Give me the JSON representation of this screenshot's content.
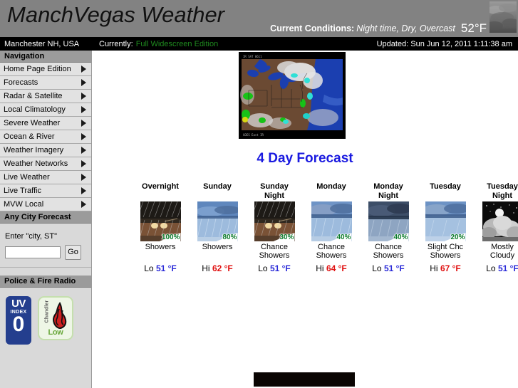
{
  "header": {
    "site_title": "ManchVegas Weather",
    "conditions_label": "Current Conditions:",
    "conditions_text": "Night time, Dry, Overcast",
    "temperature": "52°F",
    "sky_thumb_icon": "overcast-sky-photo"
  },
  "statusbar": {
    "location": "Manchester NH, USA",
    "currently_label": "Currently:",
    "edition": "Full Widescreen Edition",
    "updated": "Updated: Sun  Jun 12, 2011  1:11:38 am"
  },
  "sidebar": {
    "nav_heading": "Navigation",
    "nav_items": [
      {
        "label": "Home Page Edition",
        "icon": "chevron-right-icon"
      },
      {
        "label": "Forecasts",
        "icon": "chevron-right-icon"
      },
      {
        "label": "Radar & Satellite",
        "icon": "chevron-right-icon"
      },
      {
        "label": "Local Climatology",
        "icon": "chevron-right-icon"
      },
      {
        "label": "Severe Weather",
        "icon": "chevron-right-icon"
      },
      {
        "label": "Ocean & River",
        "icon": "chevron-right-icon"
      },
      {
        "label": "Weather Imagery",
        "icon": "chevron-right-icon"
      },
      {
        "label": "Weather Networks",
        "icon": "chevron-right-icon"
      },
      {
        "label": "Live Weather",
        "icon": "chevron-right-icon"
      },
      {
        "label": "Live Traffic",
        "icon": "chevron-right-icon"
      },
      {
        "label": "MVW Local",
        "icon": "chevron-right-icon"
      }
    ],
    "city_heading": "Any City Forecast",
    "city_label": "Enter \"city, ST\"",
    "city_value": "",
    "city_placeholder": "",
    "go_label": "Go",
    "radio_heading": "Police & Fire Radio",
    "uv": {
      "word": "UV",
      "index_word": "INDEX",
      "value": "0"
    },
    "fire": {
      "scale": "Chandler",
      "level": "Low",
      "icon": "flame-icon"
    }
  },
  "main": {
    "radar_icon": "radar-satellite-map",
    "forecast_title": "4 Day Forecast",
    "forecast": [
      {
        "day": "Overnight",
        "icon": "night-showers-icon",
        "pop": "100%",
        "desc": "Showers",
        "temp_label": "Lo",
        "temp_value": "51 °F",
        "temp_kind": "lo"
      },
      {
        "day": "Sunday",
        "icon": "day-showers-icon",
        "pop": "80%",
        "desc": "Showers",
        "temp_label": "Hi",
        "temp_value": "62 °F",
        "temp_kind": "hi"
      },
      {
        "day": "Sunday Night",
        "icon": "night-chance-showers-icon",
        "pop": "30%",
        "desc": "Chance Showers",
        "temp_label": "Lo",
        "temp_value": "51 °F",
        "temp_kind": "lo"
      },
      {
        "day": "Monday",
        "icon": "day-chance-showers-icon",
        "pop": "40%",
        "desc": "Chance Showers",
        "temp_label": "Hi",
        "temp_value": "64 °F",
        "temp_kind": "hi"
      },
      {
        "day": "Monday Night",
        "icon": "night-chance-showers-icon",
        "pop": "40%",
        "desc": "Chance Showers",
        "temp_label": "Lo",
        "temp_value": "51 °F",
        "temp_kind": "lo"
      },
      {
        "day": "Tuesday",
        "icon": "day-slight-chance-showers-icon",
        "pop": "20%",
        "desc": "Slight Chc Showers",
        "temp_label": "Hi",
        "temp_value": "67 °F",
        "temp_kind": "hi"
      },
      {
        "day": "Tuesday Night",
        "icon": "night-mostly-cloudy-icon",
        "pop": "",
        "desc": "Mostly Cloudy",
        "temp_label": "Lo",
        "temp_value": "51 °F",
        "temp_kind": "lo"
      }
    ]
  },
  "colors": {
    "header_gray": "#828282",
    "status_black": "#000000",
    "edition_green": "#1f8b1f",
    "title_blue": "#1a1ae0",
    "pop_green": "#0a7a2a",
    "lo_blue": "#2b2bd8",
    "hi_red": "#e01010",
    "uv_navy": "#243e8e",
    "fire_green": "#6aa83c"
  }
}
